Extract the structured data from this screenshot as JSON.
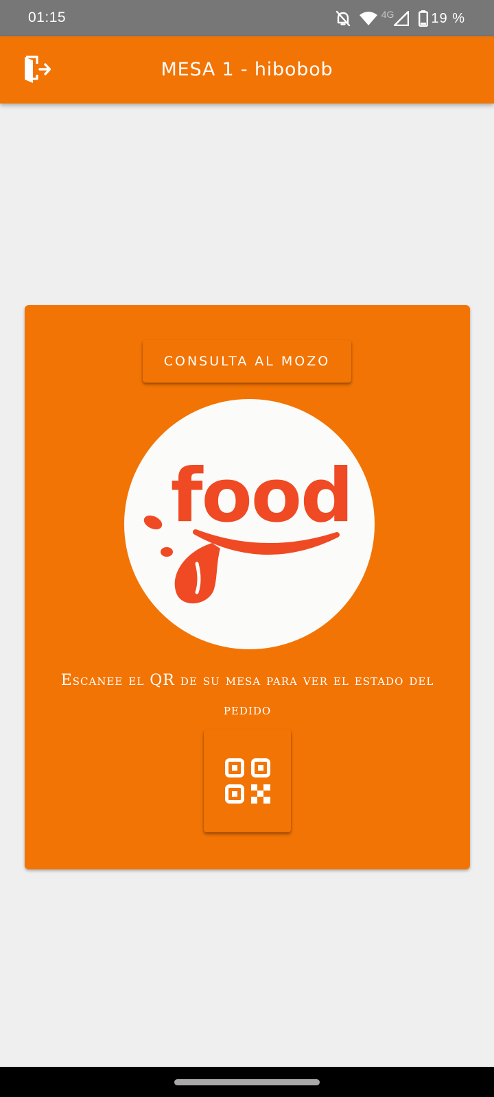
{
  "status_bar": {
    "time": "01:15",
    "network_label": "4G",
    "battery_percent": "19 %",
    "icons": [
      "bell-off-icon",
      "wifi-icon",
      "signal-icon",
      "battery-icon"
    ]
  },
  "app_bar": {
    "title": "MESA 1 - hibobob",
    "logout_icon": "logout-door-icon"
  },
  "card": {
    "consult_button_label": "CONSULTA AL MOZO",
    "logo_text": "food",
    "scan_text": "Escanee el QR de su mesa para ver el estado del pedido",
    "qr_button_icon": "qr-code-icon"
  },
  "colors": {
    "primary": "#f27405",
    "background": "#efefef",
    "status_bar": "#777777",
    "logo_red": "#ef4a23",
    "logo_background": "#fbfbfa"
  }
}
